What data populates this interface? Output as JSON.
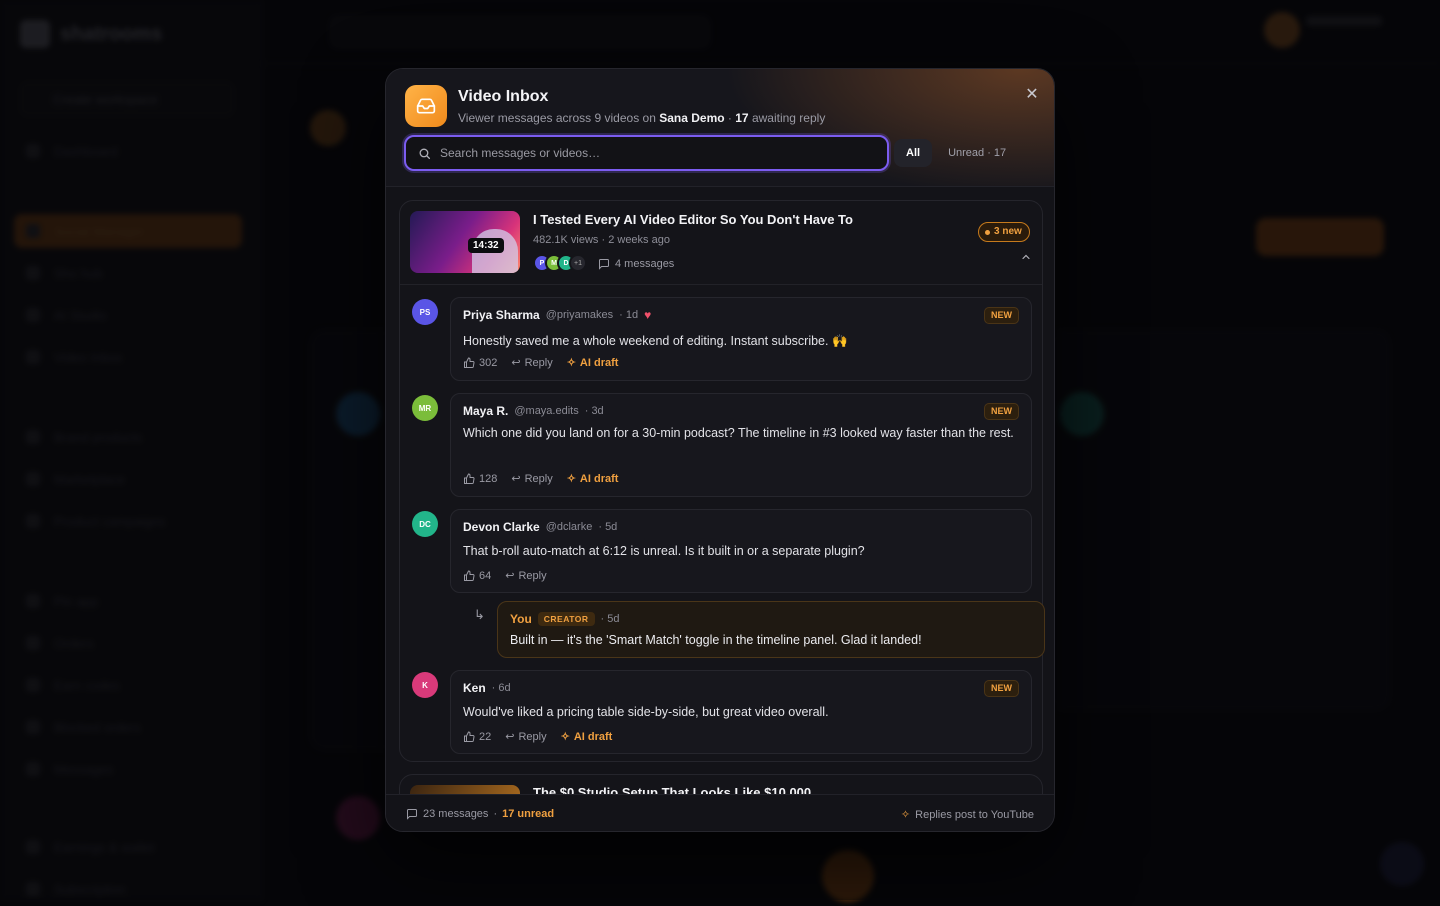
{
  "background": {
    "logo": "shatrooms",
    "create_label": "Create workspace",
    "nav": [
      "Dashboard",
      "Social Manager",
      "Sho hub",
      "AI Studio",
      "Video Inbox",
      "Brand products",
      "Marketplace",
      "Product campaigns",
      "Pin app",
      "Orders",
      "Earn codes",
      "Blocked orders",
      "Messages",
      "Earnings & wallet",
      "Subscription"
    ]
  },
  "modal": {
    "title": "Video Inbox",
    "subtitle_prefix": "Viewer messages across 9 videos on ",
    "channel": "Sana Demo",
    "subtitle_sep": " · ",
    "awaiting_count": "17",
    "awaiting_suffix": " awaiting reply",
    "close_label": "✕",
    "search_placeholder": "Search messages or videos…",
    "filters": {
      "all": "All",
      "unread": "Unread · 17"
    },
    "footer": {
      "total": "23 messages",
      "sep": " · ",
      "unread": "17 unread",
      "right": "Replies post to YouTube"
    }
  },
  "video": {
    "title": "I Tested Every AI Video Editor So You Don't Have To",
    "meta": "482.1K views · 2 weeks ago",
    "duration": "14:32",
    "new_badge": "3 new",
    "avatars": [
      "P",
      "M",
      "D"
    ],
    "avatars_more": "+1",
    "messages": "4 messages",
    "second_title": "The $0 Studio Setup That Looks Like $10,000"
  },
  "comments": [
    {
      "initials": "PS",
      "name": "Priya Sharma",
      "handle": "@priyamakes",
      "time": "· 1d",
      "badge": "NEW",
      "text": "Honestly saved me a whole weekend of editing. Instant subscribe. 🙌",
      "likes": "302",
      "reply": "Reply",
      "ai": "AI draft",
      "color": "#5a55e6"
    },
    {
      "initials": "MR",
      "name": "Maya R.",
      "handle": "@maya.edits",
      "time": "· 3d",
      "badge": "NEW",
      "text": "Which one did you land on for a 30-min podcast? The timeline in #3 looked way faster than the rest.",
      "likes": "128",
      "reply": "Reply",
      "ai": "AI draft",
      "color": "#7bbd3a"
    },
    {
      "initials": "DC",
      "name": "Devon Clarke",
      "handle": "@dclarke",
      "time": "· 5d",
      "badge": "",
      "text": "That b-roll auto-match at 6:12 is unreal. Is it built in or a separate plugin?",
      "likes": "64",
      "reply": "Reply",
      "ai": "",
      "color": "#22b58a"
    },
    {
      "initials": "K",
      "name": "Ken",
      "handle": "",
      "time": "· 6d",
      "badge": "NEW",
      "text": "Would've liked a pricing table side-by-side, but great video overall.",
      "likes": "22",
      "reply": "Reply",
      "ai": "AI draft",
      "color": "#d93a7a"
    }
  ],
  "creator_reply": {
    "you": "You",
    "tag": "CREATOR",
    "time": "· 5d",
    "text": "Built in — it's the 'Smart Match' toggle in the timeline panel. Glad it landed!"
  },
  "colors": {
    "accent": "#f0a040",
    "focus": "#7b5cf0",
    "heart": "#f0506a"
  }
}
